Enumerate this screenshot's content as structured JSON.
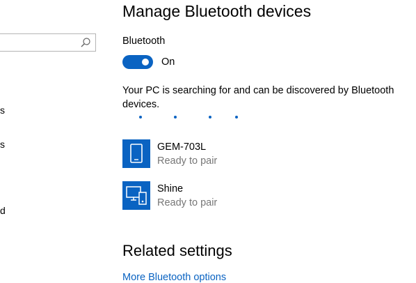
{
  "sidebar": {
    "search": {
      "placeholder": ""
    },
    "items": [
      {
        "label": "s"
      },
      {
        "label": "s"
      },
      {
        "label": "d"
      }
    ]
  },
  "main": {
    "title": "Manage Bluetooth devices",
    "bluetooth_label": "Bluetooth",
    "toggle_state": "On",
    "status_text": "Your PC is searching for and can be discovered by Bluetooth devices.",
    "devices": [
      {
        "name": "GEM-703L",
        "status": "Ready to pair",
        "icon": "phone-icon"
      },
      {
        "name": "Shine",
        "status": "Ready to pair",
        "icon": "multiple-devices-icon"
      }
    ],
    "related_title": "Related settings",
    "related_link": "More Bluetooth options"
  },
  "colors": {
    "accent": "#0a63c2",
    "secondary_text": "#767676",
    "background": "#ffffff"
  }
}
